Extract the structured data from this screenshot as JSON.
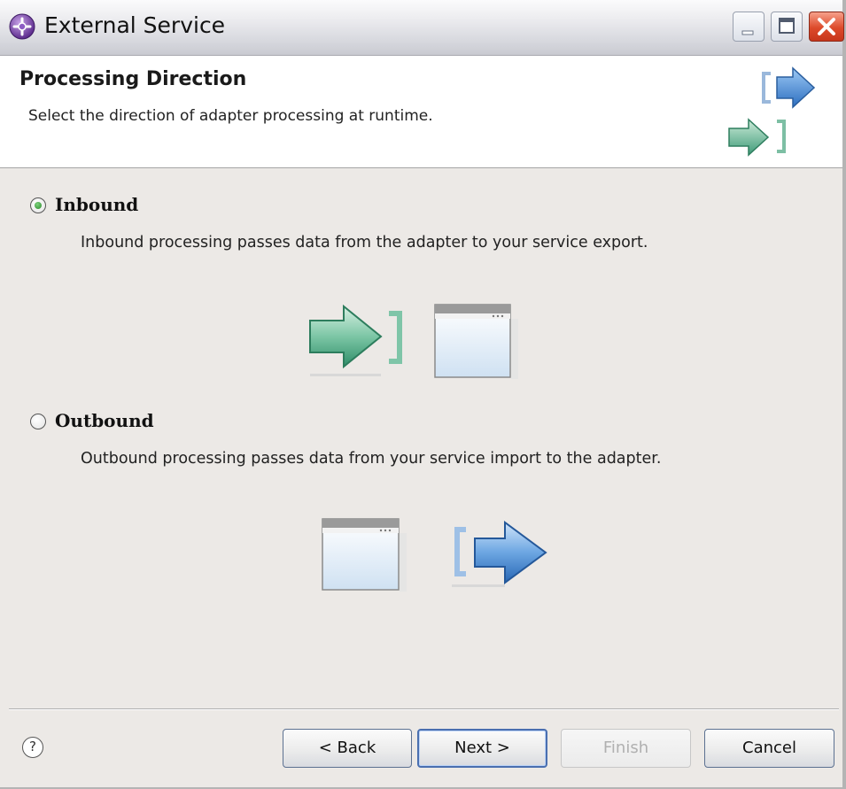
{
  "window": {
    "title": "External Service"
  },
  "header": {
    "title": "Processing Direction",
    "description": "Select the direction of adapter processing at runtime."
  },
  "options": [
    {
      "label": "Inbound",
      "description": "Inbound processing passes data from the adapter to your service export.",
      "selected": true
    },
    {
      "label": "Outbound",
      "description": "Outbound processing passes data from your service import to the adapter.",
      "selected": false
    }
  ],
  "footer": {
    "help_icon": "?",
    "back_label": "< Back",
    "next_label": "Next >",
    "finish_label": "Finish",
    "cancel_label": "Cancel"
  },
  "icons": {
    "app": "eclipse-wizard-icon",
    "help": "question-circle-icon",
    "arrow_in": "green-arrow-into-bracket-icon",
    "arrow_out": "blue-arrow-out-of-bracket-icon",
    "window": "application-window-icon"
  },
  "colors": {
    "inbound_arrow": "#3f9a78",
    "outbound_arrow": "#3d7fc9",
    "close_button": "#dd4a2a"
  }
}
